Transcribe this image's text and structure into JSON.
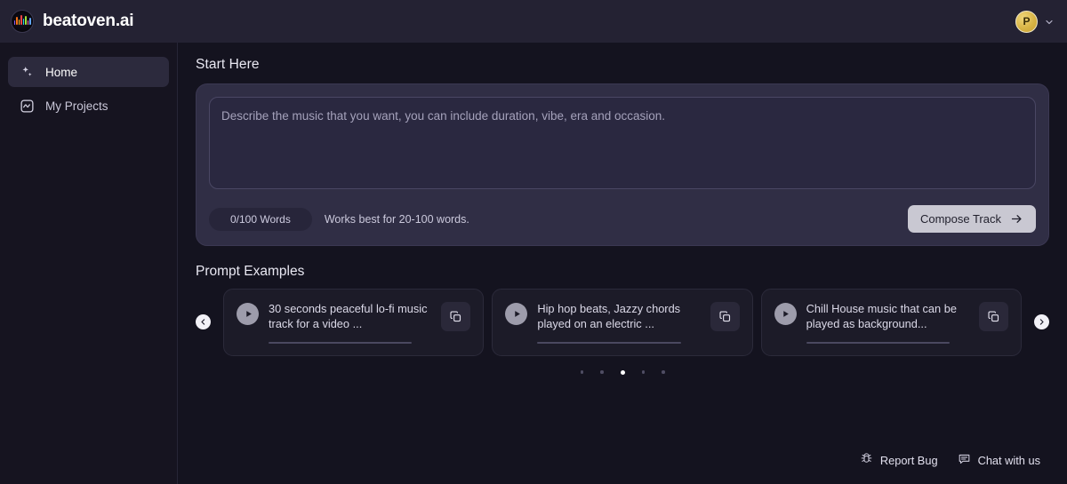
{
  "topbar": {
    "brand_name": "beatoven.ai",
    "logo_icon": "equalizer-logo-icon",
    "avatar_initial": "P",
    "chevron_icon": "chevron-down-icon"
  },
  "sidebar": {
    "items": [
      {
        "label": "Home",
        "icon": "sparkles-icon",
        "active": true
      },
      {
        "label": "My Projects",
        "icon": "waveform-square-icon",
        "active": false
      }
    ]
  },
  "main": {
    "start_here_title": "Start Here",
    "prompt": {
      "value": "",
      "placeholder": "Describe the music that you want, you can include duration, vibe, era and occasion."
    },
    "word_count": "0/100 Words",
    "hint": "Works best for 20-100 words.",
    "compose_label": "Compose Track",
    "compose_icon": "arrow-right-icon"
  },
  "examples": {
    "title": "Prompt Examples",
    "prev_icon": "chevron-left-circle-icon",
    "next_icon": "chevron-right-circle-icon",
    "cards": [
      {
        "text": "30 seconds peaceful lo-fi music track for a video ...",
        "play_icon": "play-icon",
        "copy_icon": "copy-icon"
      },
      {
        "text": "Hip hop beats, Jazzy chords played on an electric ...",
        "play_icon": "play-icon",
        "copy_icon": "copy-icon"
      },
      {
        "text": "Chill House music that can be played as background...",
        "play_icon": "play-icon",
        "copy_icon": "copy-icon"
      }
    ],
    "dots": {
      "count": 5,
      "active_index": 2
    }
  },
  "footer": {
    "report_bug_label": "Report Bug",
    "report_bug_icon": "bug-icon",
    "chat_label": "Chat with us",
    "chat_icon": "chat-bubble-icon"
  },
  "colors": {
    "page_bg": "#14131f",
    "topbar_bg": "#242233",
    "panel_bg": "#302e45",
    "accent_avatar": "#d8b445",
    "compose_btn_bg": "#c9c8d2"
  }
}
